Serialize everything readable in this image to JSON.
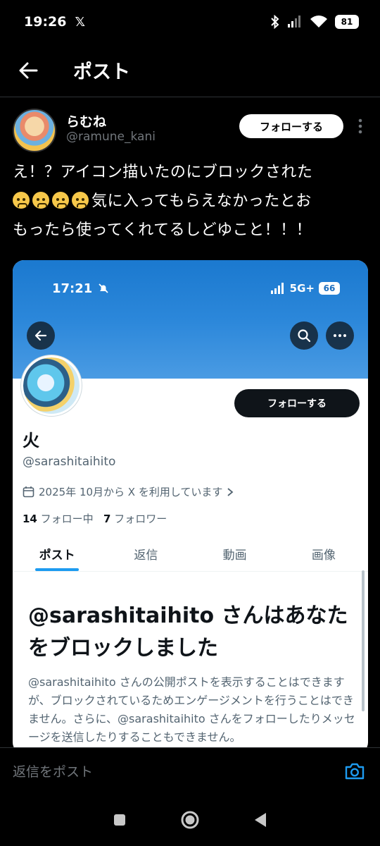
{
  "status_bar": {
    "time": "19:26",
    "x_logo": "𝕏",
    "battery": "81",
    "icons": [
      "bluetooth-icon",
      "signal-icon",
      "wifi-icon",
      "battery-icon"
    ]
  },
  "header": {
    "title": "ポスト",
    "back_icon": "back-arrow-icon"
  },
  "post": {
    "author_name": "らむね",
    "author_handle": "@ramune_kani",
    "follow_label": "フォローする",
    "text_line1": "え！？アイコン描いたのにブロックされた",
    "text_line2_after_emoji": "気に入ってもらえなかったとお",
    "text_line3": "もったら使ってくれてるしどゆこと！！！",
    "emoji_count": 4,
    "emoji_name": "crying-cat-face"
  },
  "embedded": {
    "status_time": "17:21",
    "status_network": "5G+",
    "status_battery": "66",
    "profile_name": "火",
    "profile_handle": "@sarashitaihito",
    "follow_label": "フォローする",
    "joined": "2025年 10月から X を利用しています",
    "following_count": "14",
    "following_label": "フォロー中",
    "followers_count": "7",
    "followers_label": "フォロワー",
    "tabs": [
      {
        "label": "ポスト",
        "active": true
      },
      {
        "label": "返信",
        "active": false
      },
      {
        "label": "動画",
        "active": false
      },
      {
        "label": "画像",
        "active": false
      }
    ],
    "block_title": "@sarashitaihito さんはあなたをブロックしました",
    "block_body": "@sarashitaihito さんの公開ポストを表示することはできますが、ブロックされているためエンゲージメントを行うことはできません。さらに、@sarashitaihito さんをフォローしたりメッセージを送信したりすることもできません。",
    "accent_color": "#1d9bf0",
    "banner_color": "#2b87da"
  },
  "reply_bar": {
    "placeholder": "返信をポスト",
    "camera_icon": "camera-icon",
    "accent_color": "#1d9bf0"
  },
  "nav_bar": {
    "buttons": [
      "recents-square-icon",
      "home-circle-icon",
      "back-triangle-icon"
    ]
  }
}
